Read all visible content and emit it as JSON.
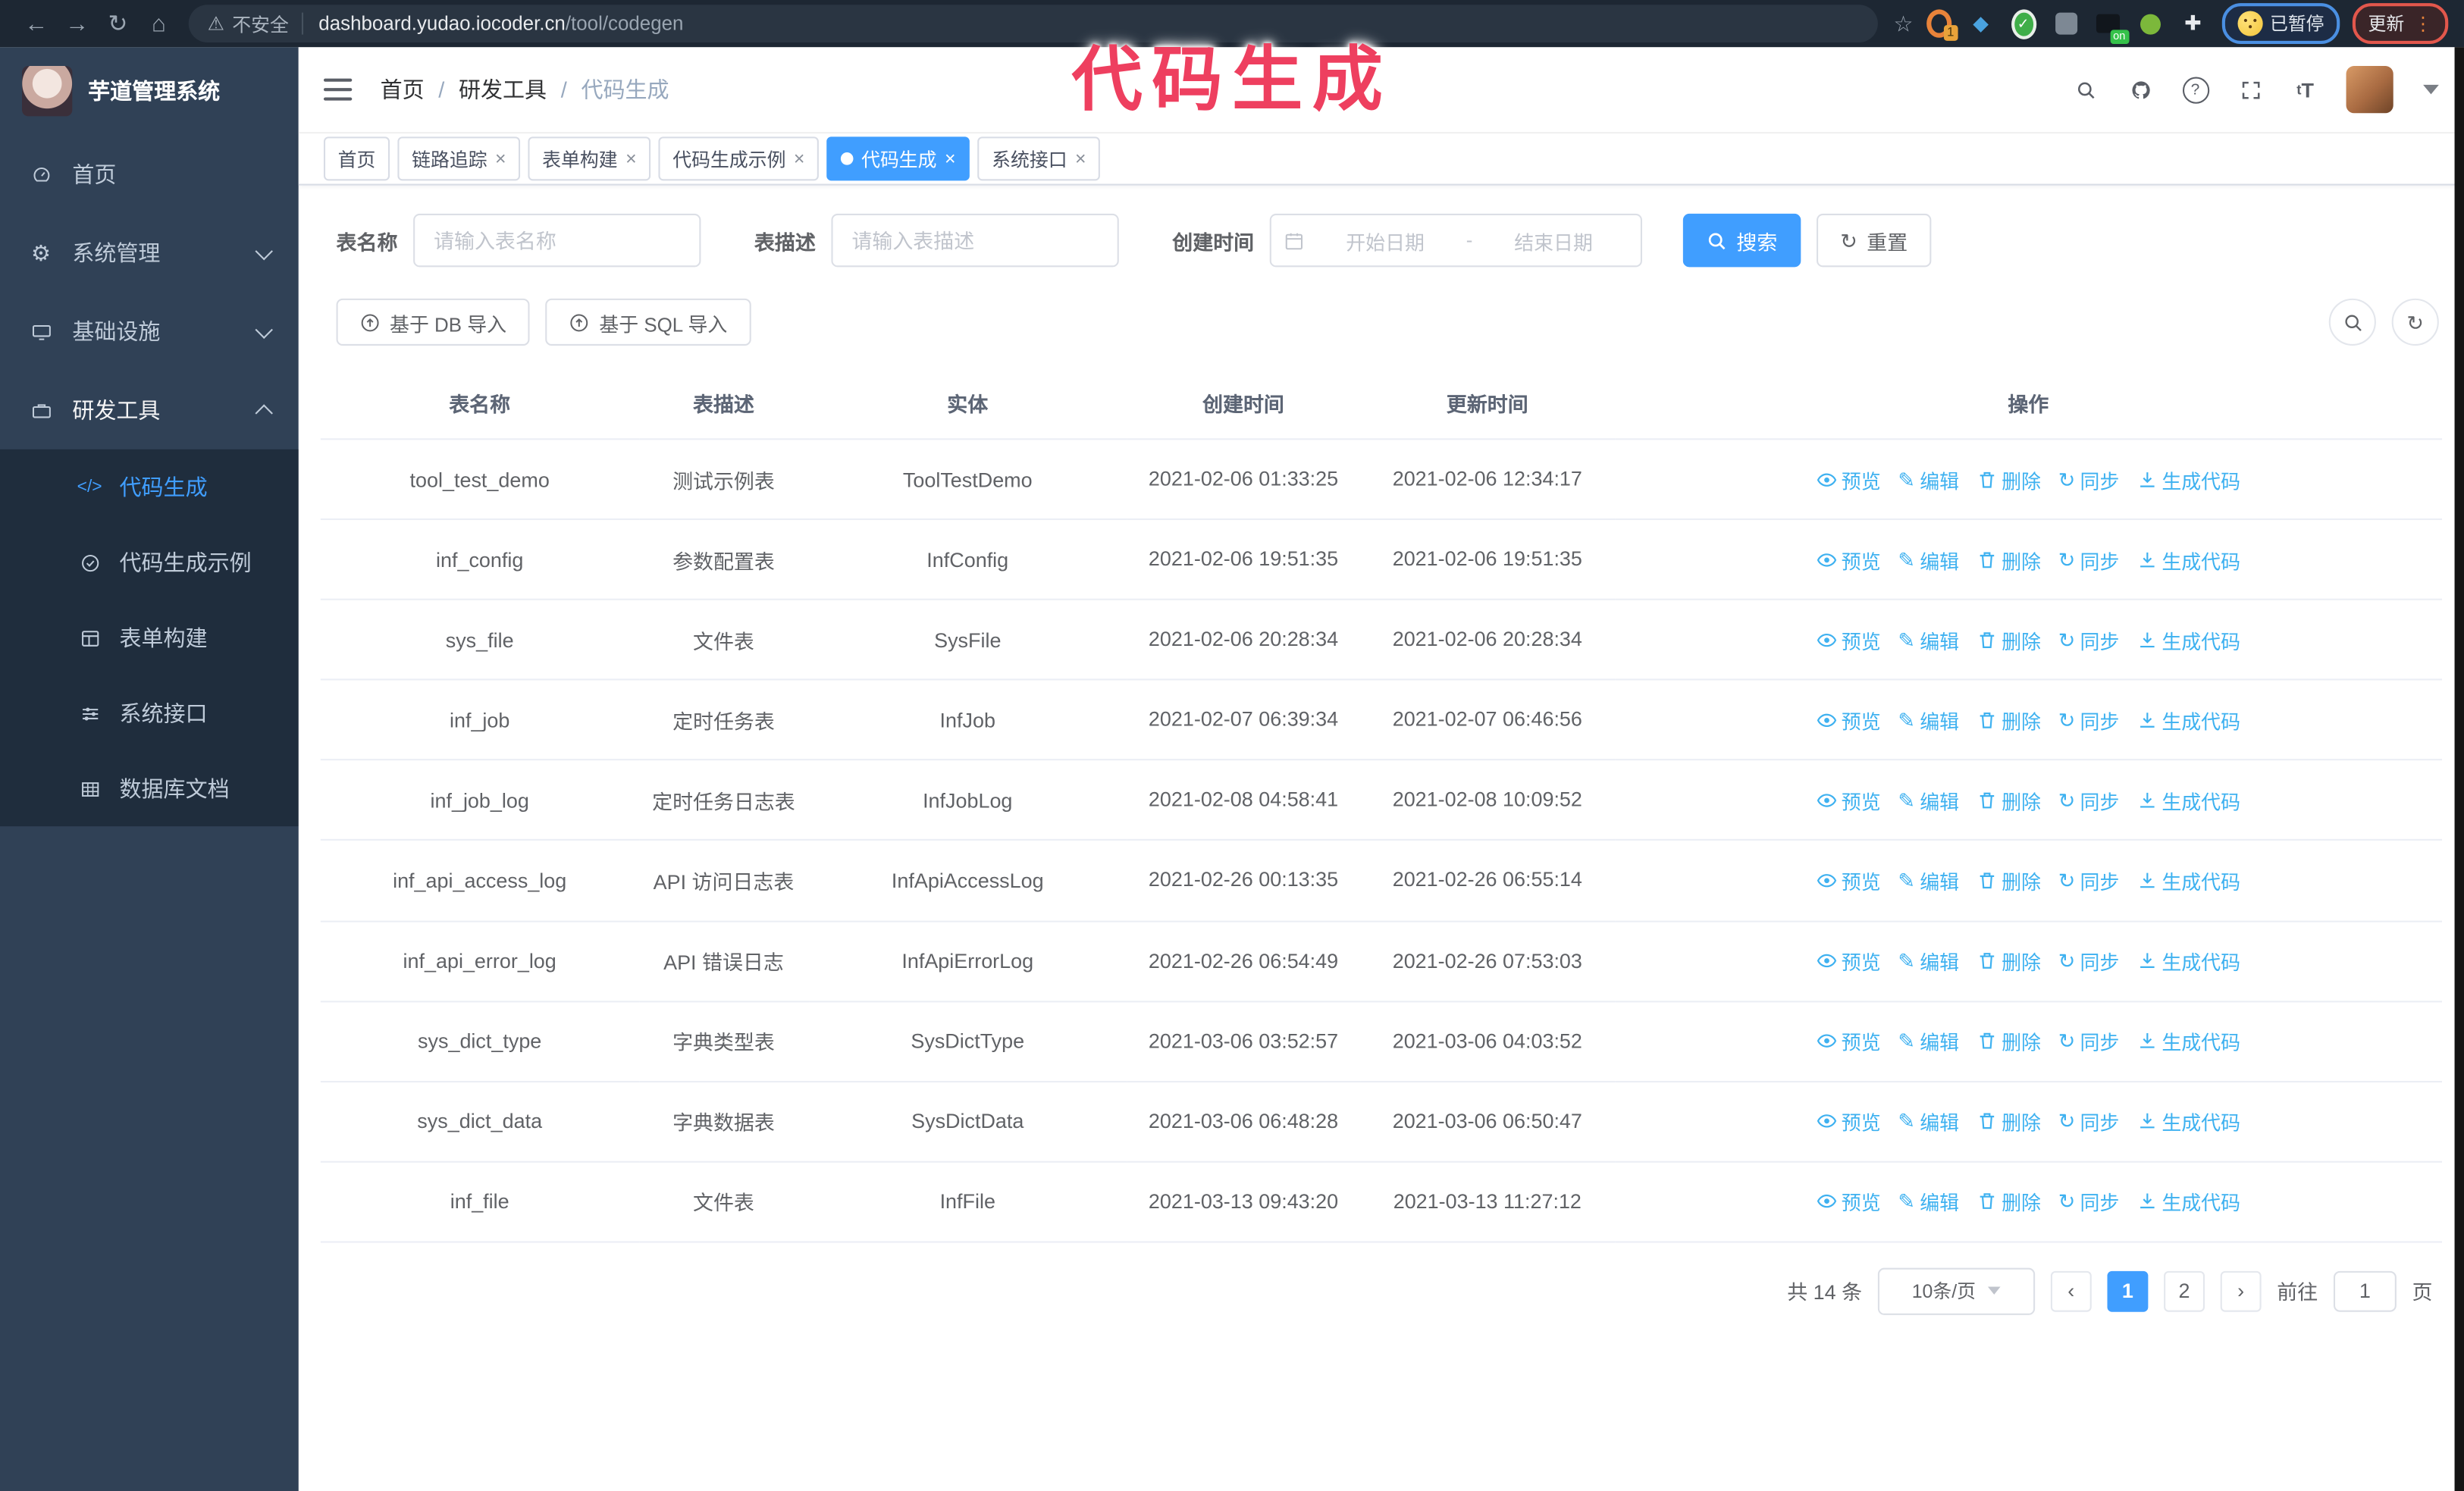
{
  "browser": {
    "back": "←",
    "forward": "→",
    "reload": "↻",
    "home": "⌂",
    "warning": "⚠",
    "security_label": "不安全",
    "url_domain": "dashboard.yudao.iocoder.cn",
    "url_path": "/tool/codegen",
    "bookmark_star": "☆",
    "ext_badge_count": "1",
    "ext_badge_on": "on",
    "ext_check": "✓",
    "ext_puzzle": "✚",
    "profile_label": "已暂停",
    "update_label": "更新",
    "menu_dots": "⋮"
  },
  "annotation": {
    "text": "代码生成",
    "color": "#ee3f5f"
  },
  "sidebar": {
    "app_title": "芋道管理系统",
    "items": [
      {
        "label": "首页"
      },
      {
        "label": "系统管理"
      },
      {
        "label": "基础设施"
      },
      {
        "label": "研发工具"
      }
    ],
    "submenu": [
      {
        "label": "代码生成"
      },
      {
        "label": "代码生成示例"
      },
      {
        "label": "表单构建"
      },
      {
        "label": "系统接口"
      },
      {
        "label": "数据库文档"
      }
    ],
    "code_glyph": "</>"
  },
  "breadcrumb": {
    "items": [
      "首页",
      "研发工具",
      "代码生成"
    ],
    "separator": "/"
  },
  "tags": {
    "close": "×",
    "items": [
      {
        "label": "首页"
      },
      {
        "label": "链路追踪"
      },
      {
        "label": "表单构建"
      },
      {
        "label": "代码生成示例"
      },
      {
        "label": "代码生成"
      },
      {
        "label": "系统接口"
      }
    ]
  },
  "header_icons": {
    "help_glyph": "?",
    "font_size_glyph": "T"
  },
  "filters": {
    "name_label": "表名称",
    "name_placeholder": "请输入表名称",
    "desc_label": "表描述",
    "desc_placeholder": "请输入表描述",
    "date_label": "创建时间",
    "date_start_placeholder": "开始日期",
    "range_separator": "-",
    "date_end_placeholder": "结束日期",
    "search_label": "搜索",
    "reset_label": "重置",
    "reset_glyph": "↻"
  },
  "toolbar": {
    "import_db": "基于 DB 导入",
    "import_sql": "基于 SQL 导入",
    "refresh_glyph": "↻"
  },
  "table": {
    "columns": [
      "表名称",
      "表描述",
      "实体",
      "创建时间",
      "更新时间",
      "操作"
    ],
    "actions": [
      "预览",
      "编辑",
      "删除",
      "同步",
      "生成代码"
    ],
    "edit_glyph": "✎",
    "sync_glyph": "↻",
    "rows": [
      {
        "name": "tool_test_demo",
        "desc": "测试示例表",
        "entity": "ToolTestDemo",
        "created": "2021-02-06 01:33:25",
        "updated": "2021-02-06 12:34:17"
      },
      {
        "name": "inf_config",
        "desc": "参数配置表",
        "entity": "InfConfig",
        "created": "2021-02-06 19:51:35",
        "updated": "2021-02-06 19:51:35"
      },
      {
        "name": "sys_file",
        "desc": "文件表",
        "entity": "SysFile",
        "created": "2021-02-06 20:28:34",
        "updated": "2021-02-06 20:28:34"
      },
      {
        "name": "inf_job",
        "desc": "定时任务表",
        "entity": "InfJob",
        "created": "2021-02-07 06:39:34",
        "updated": "2021-02-07 06:46:56"
      },
      {
        "name": "inf_job_log",
        "desc": "定时任务日志表",
        "entity": "InfJobLog",
        "created": "2021-02-08 04:58:41",
        "updated": "2021-02-08 10:09:52"
      },
      {
        "name": "inf_api_access_log",
        "desc": "API 访问日志表",
        "entity": "InfApiAccessLog",
        "created": "2021-02-26 00:13:35",
        "updated": "2021-02-26 06:55:14"
      },
      {
        "name": "inf_api_error_log",
        "desc": "API 错误日志",
        "entity": "InfApiErrorLog",
        "created": "2021-02-26 06:54:49",
        "updated": "2021-02-26 07:53:03"
      },
      {
        "name": "sys_dict_type",
        "desc": "字典类型表",
        "entity": "SysDictType",
        "created": "2021-03-06 03:52:57",
        "updated": "2021-03-06 04:03:52"
      },
      {
        "name": "sys_dict_data",
        "desc": "字典数据表",
        "entity": "SysDictData",
        "created": "2021-03-06 06:48:28",
        "updated": "2021-03-06 06:50:47"
      },
      {
        "name": "inf_file",
        "desc": "文件表",
        "entity": "InfFile",
        "created": "2021-03-13 09:43:20",
        "updated": "2021-03-13 11:27:12"
      }
    ]
  },
  "pagination": {
    "total": "共 14 条",
    "page_size": "10条/页",
    "prev": "‹",
    "next": "›",
    "page1": "1",
    "page2": "2",
    "goto_label": "前往",
    "goto_value": "1",
    "page_unit": "页"
  },
  "colors": {
    "accent": "#409eff",
    "action_link": "#3eb1f0",
    "annotation": "#ee3f5f",
    "sidebar_bg": "#304156",
    "submenu_bg": "#1f2d3d",
    "chrome_bg": "#1d2733",
    "paused_border": "#4a8fe2",
    "update_border": "#e2574c"
  }
}
